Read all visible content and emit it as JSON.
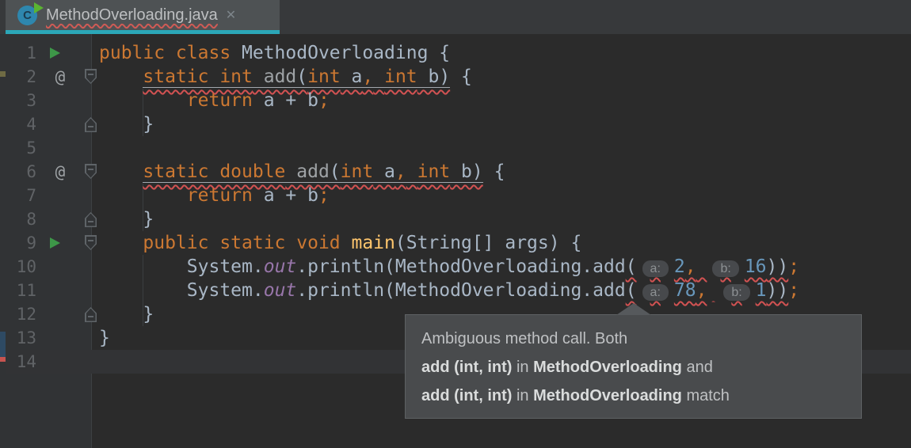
{
  "colors": {
    "accent_teal": "#2BA7B8",
    "error_red": "#D25252",
    "keyword_orange": "#CC7832",
    "number_blue": "#6897BB",
    "method_yellow": "#FFC66D",
    "field_purple": "#9876AA",
    "editor_bg": "#2B2B2B",
    "gutter_bg": "#313335"
  },
  "tab_bar": {
    "active_tab": {
      "title": "MethodOverloading.java",
      "icon_letter": "C",
      "close_glyph": "✕"
    }
  },
  "editor": {
    "at_glyph": "@",
    "lines": [
      {
        "n": "1",
        "run": true,
        "groups": [
          {
            "w": null,
            "tokens": [
              {
                "t": "public class ",
                "c": "kw"
              },
              {
                "t": "MethodOverloading {",
                "c": "pl"
              }
            ]
          }
        ]
      },
      {
        "n": "2",
        "at": true,
        "fold": "top",
        "groups": [
          {
            "w": null,
            "tokens": [
              {
                "t": "    ",
                "c": "pl"
              }
            ]
          },
          {
            "w": "sig",
            "tokens": [
              {
                "t": "static int",
                "c": "kw"
              },
              {
                "t": " add",
                "c": "decl"
              },
              {
                "t": "(",
                "c": "pl"
              },
              {
                "t": "int",
                "c": "kw"
              },
              {
                "t": " a",
                "c": "pl"
              },
              {
                "t": ",",
                "c": "sc"
              },
              {
                "t": " ",
                "c": "pl"
              },
              {
                "t": "int",
                "c": "kw"
              },
              {
                "t": " b)",
                "c": "pl"
              }
            ]
          },
          {
            "w": null,
            "tokens": [
              {
                "t": " {",
                "c": "pl"
              }
            ]
          }
        ]
      },
      {
        "n": "3",
        "groups": [
          {
            "w": null,
            "tokens": [
              {
                "t": "        ",
                "c": "pl"
              },
              {
                "t": "return",
                "c": "kw"
              },
              {
                "t": " a + b",
                "c": "pl"
              },
              {
                "t": ";",
                "c": "sc"
              }
            ]
          }
        ]
      },
      {
        "n": "4",
        "fold": "bottom",
        "groups": [
          {
            "w": null,
            "tokens": [
              {
                "t": "    }",
                "c": "pl"
              }
            ]
          }
        ]
      },
      {
        "n": "5",
        "groups": []
      },
      {
        "n": "6",
        "at": true,
        "fold": "top",
        "groups": [
          {
            "w": null,
            "tokens": [
              {
                "t": "    ",
                "c": "pl"
              }
            ]
          },
          {
            "w": "sig",
            "tokens": [
              {
                "t": "static double",
                "c": "kw"
              },
              {
                "t": " add",
                "c": "decl"
              },
              {
                "t": "(",
                "c": "pl"
              },
              {
                "t": "int",
                "c": "kw"
              },
              {
                "t": " a",
                "c": "pl"
              },
              {
                "t": ",",
                "c": "sc"
              },
              {
                "t": " ",
                "c": "pl"
              },
              {
                "t": "int",
                "c": "kw"
              },
              {
                "t": " b)",
                "c": "pl"
              }
            ]
          },
          {
            "w": null,
            "tokens": [
              {
                "t": " {",
                "c": "pl"
              }
            ]
          }
        ]
      },
      {
        "n": "7",
        "groups": [
          {
            "w": null,
            "tokens": [
              {
                "t": "        ",
                "c": "pl"
              },
              {
                "t": "return",
                "c": "kw"
              },
              {
                "t": " a + b",
                "c": "pl"
              },
              {
                "t": ";",
                "c": "sc"
              }
            ]
          }
        ]
      },
      {
        "n": "8",
        "fold": "bottom",
        "groups": [
          {
            "w": null,
            "tokens": [
              {
                "t": "    }",
                "c": "pl"
              }
            ]
          }
        ]
      },
      {
        "n": "9",
        "run": true,
        "fold": "top",
        "groups": [
          {
            "w": null,
            "tokens": [
              {
                "t": "    ",
                "c": "pl"
              },
              {
                "t": "public static void",
                "c": "kw"
              },
              {
                "t": " main",
                "c": "fn"
              },
              {
                "t": "(String[] args) {",
                "c": "pl"
              }
            ]
          }
        ]
      },
      {
        "n": "10",
        "groups": [
          {
            "w": null,
            "tokens": [
              {
                "t": "        System.",
                "c": "pl"
              },
              {
                "t": "out",
                "c": "fld"
              },
              {
                "t": ".println(MethodOverloading.add",
                "c": "pl"
              }
            ]
          },
          {
            "w": "call",
            "tokens": [
              {
                "t": "(",
                "c": "pl"
              },
              {
                "t": "a:",
                "c": "hint"
              },
              {
                "t": "2",
                "c": "num"
              },
              {
                "t": ",",
                "c": "sc"
              },
              {
                "t": " ",
                "c": "pl"
              },
              {
                "t": "b:",
                "c": "hint"
              },
              {
                "t": "16",
                "c": "num"
              },
              {
                "t": "))",
                "c": "pl"
              }
            ]
          },
          {
            "w": null,
            "tokens": [
              {
                "t": ";",
                "c": "sc"
              }
            ]
          }
        ]
      },
      {
        "n": "11",
        "groups": [
          {
            "w": null,
            "tokens": [
              {
                "t": "        System.",
                "c": "pl"
              },
              {
                "t": "out",
                "c": "fld"
              },
              {
                "t": ".println(MethodOverloading.add",
                "c": "pl"
              }
            ]
          },
          {
            "w": "call",
            "tokens": [
              {
                "t": "(",
                "c": "pl"
              },
              {
                "t": "a:",
                "c": "hint"
              },
              {
                "t": "78",
                "c": "num"
              },
              {
                "t": ",",
                "c": "sc"
              },
              {
                "t": " ",
                "c": "pl"
              },
              {
                "t": "b:",
                "c": "hint"
              },
              {
                "t": "1",
                "c": "num"
              },
              {
                "t": "))",
                "c": "pl"
              }
            ]
          },
          {
            "w": null,
            "tokens": [
              {
                "t": ";",
                "c": "sc"
              }
            ]
          }
        ]
      },
      {
        "n": "12",
        "fold": "bottom",
        "groups": [
          {
            "w": null,
            "tokens": [
              {
                "t": "    }",
                "c": "pl"
              }
            ]
          }
        ]
      },
      {
        "n": "13",
        "groups": [
          {
            "w": null,
            "tokens": [
              {
                "t": "}",
                "c": "pl"
              }
            ]
          }
        ]
      },
      {
        "n": "14",
        "current": true,
        "groups": []
      }
    ]
  },
  "tooltip": {
    "rows": [
      [
        {
          "t": "Ambiguous method call. Both",
          "b": false
        }
      ],
      [
        {
          "t": "add (int, int)",
          "b": true
        },
        {
          "t": " in ",
          "b": false
        },
        {
          "t": "MethodOverloading",
          "b": true
        },
        {
          "t": " and",
          "b": false
        }
      ],
      [
        {
          "t": "add (int, int)",
          "b": true
        },
        {
          "t": " in ",
          "b": false
        },
        {
          "t": "MethodOverloading",
          "b": true
        },
        {
          "t": " match",
          "b": false
        }
      ]
    ]
  }
}
